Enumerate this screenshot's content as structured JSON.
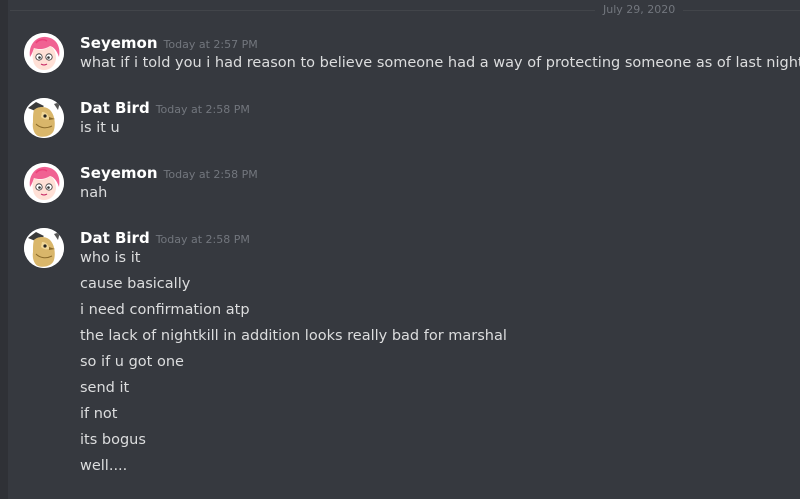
{
  "date_divider": "July 29, 2020",
  "messages": [
    {
      "username": "Seyemon",
      "timestamp": "Today at 2:57 PM",
      "avatar": "pink-hair-character-avatar",
      "lines": [
        "what if i told you i had reason to believe someone had a way of protecting someone as of last night."
      ]
    },
    {
      "username": "Dat Bird",
      "timestamp": "Today at 2:58 PM",
      "avatar": "bird-avatar",
      "lines": [
        "is it u"
      ]
    },
    {
      "username": "Seyemon",
      "timestamp": "Today at 2:58 PM",
      "avatar": "pink-hair-character-avatar",
      "lines": [
        "nah"
      ]
    },
    {
      "username": "Dat Bird",
      "timestamp": "Today at 2:58 PM",
      "avatar": "bird-avatar",
      "lines": [
        "who is it",
        "cause basically",
        "i need confirmation atp",
        "the lack of nightkill in addition looks really bad for marshal",
        "so if u got one",
        "send it",
        "if not",
        "its bogus",
        "well...."
      ]
    }
  ],
  "colors": {
    "background": "#36393f",
    "username": "#ffffff",
    "text": "#dcddde",
    "muted": "#72767d"
  }
}
